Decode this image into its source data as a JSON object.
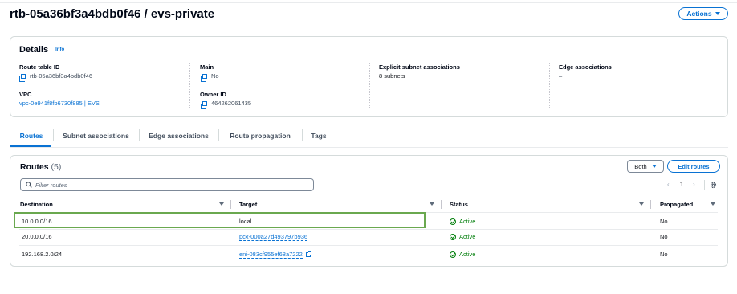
{
  "header": {
    "title": "rtb-05a36bf3a4bdb0f46 / evs-private",
    "actions_label": "Actions"
  },
  "details": {
    "title": "Details",
    "info_label": "Info",
    "route_table_id": {
      "label": "Route table ID",
      "value": "rtb-05a36bf3a4bdb0f46"
    },
    "main": {
      "label": "Main",
      "value": "No"
    },
    "explicit": {
      "label": "Explicit subnet associations",
      "value": "8 subnets"
    },
    "edge": {
      "label": "Edge associations",
      "value": "–"
    },
    "vpc": {
      "label": "VPC",
      "value": "vpc-0e941f8fb6730f885 | EVS"
    },
    "owner": {
      "label": "Owner ID",
      "value": "464262061435"
    }
  },
  "tabs": [
    "Routes",
    "Subnet associations",
    "Edge associations",
    "Route propagation",
    "Tags"
  ],
  "routes": {
    "title": "Routes",
    "count": "(5)",
    "both_label": "Both",
    "edit_label": "Edit routes",
    "filter_placeholder": "Filter routes",
    "page": "1",
    "prev": "‹",
    "next": "›",
    "columns": [
      "Destination",
      "Target",
      "Status",
      "Propagated"
    ],
    "rows": [
      {
        "destination": "10.0.0.0/16",
        "target": "local",
        "status": "Active",
        "propagated": "No"
      },
      {
        "destination": "20.0.0.0/16",
        "target": "pcx-000a27d493797b936",
        "status": "Active",
        "propagated": "No"
      },
      {
        "destination": "192.168.2.0/24",
        "target": "eni-083cf955ef68a7222",
        "status": "Active",
        "propagated": "No"
      }
    ]
  },
  "colors": {
    "accent": "#0972d3",
    "success": "#037f0c",
    "highlight": "#6aa84f"
  }
}
